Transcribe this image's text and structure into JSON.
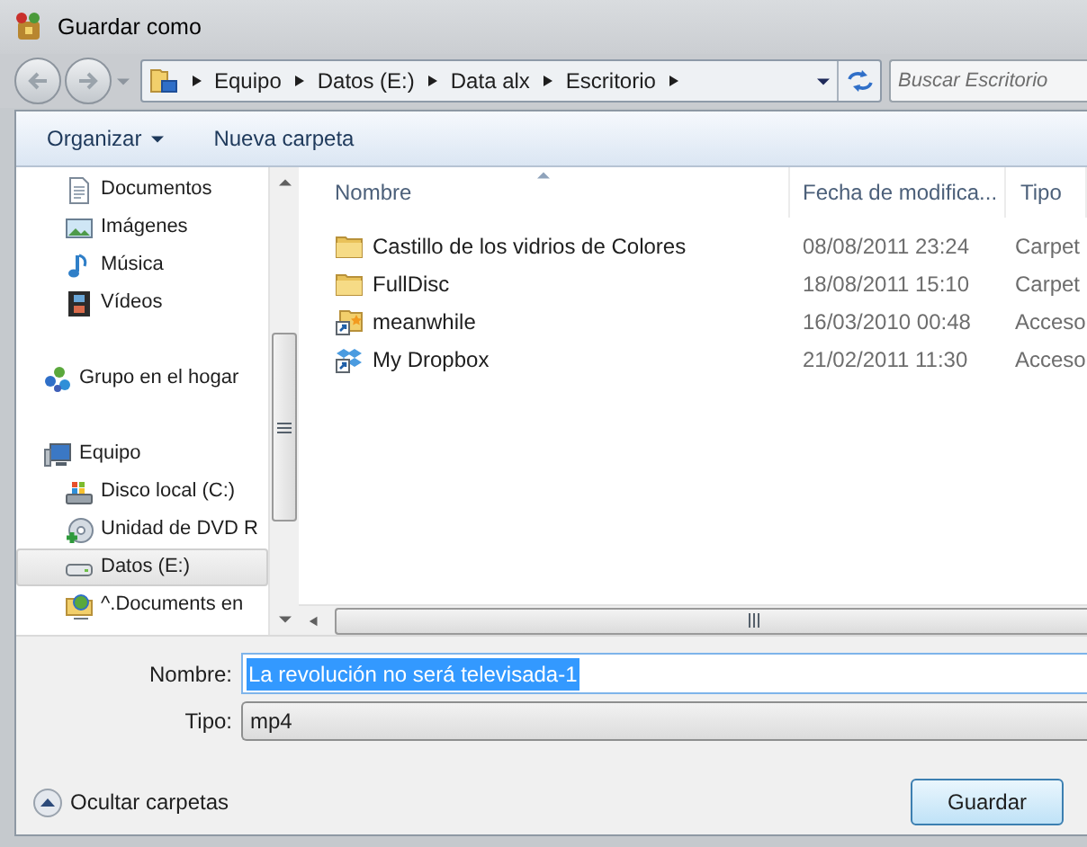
{
  "window": {
    "title": "Guardar como"
  },
  "address_bar": {
    "path": [
      "Equipo",
      "Datos (E:)",
      "Data alx",
      "Escritorio"
    ]
  },
  "search": {
    "placeholder": "Buscar Escritorio"
  },
  "toolbar": {
    "buttons": [
      {
        "label": "Organizar",
        "kind": "menu"
      },
      {
        "label": "Nueva carpeta",
        "kind": "plain"
      }
    ]
  },
  "sidebar": {
    "items": [
      {
        "children": [
          {
            "label": "Documentos",
            "selected": false
          },
          {
            "label": "Imágenes",
            "selected": false
          },
          {
            "label": "Música",
            "selected": false
          },
          {
            "label": "Vídeos",
            "selected": false
          }
        ]
      },
      {
        "label": "Grupo en el hogar",
        "selected": false
      },
      {
        "label": "Equipo",
        "selected": false,
        "children": [
          {
            "label": "Disco local (C:)",
            "selected": false
          },
          {
            "label": "Unidad de DVD R",
            "selected": false
          },
          {
            "label": "Datos (E:)",
            "selected": true
          },
          {
            "label": "^.Documents en",
            "selected": false
          }
        ]
      }
    ]
  },
  "file_list": {
    "columns": [
      {
        "label": "Nombre",
        "sorted": true
      },
      {
        "label": "Fecha de modifica...",
        "sorted": false
      },
      {
        "label": "Tipo",
        "sorted": false
      }
    ],
    "rows": [
      {
        "kind": "folder",
        "name": "Castillo de los vidrios de Colores",
        "date": "08/08/2011 23:24",
        "type": "Carpet"
      },
      {
        "kind": "folder",
        "name": "FullDisc",
        "date": "18/08/2011 15:10",
        "type": "Carpet"
      },
      {
        "kind": "shortcut",
        "name": "meanwhile",
        "date": "16/03/2010 00:48",
        "type": "Acceso"
      },
      {
        "kind": "shortcut",
        "name": "My Dropbox",
        "date": "21/02/2011 11:30",
        "type": "Acceso"
      }
    ]
  },
  "form": {
    "name_label": "Nombre:",
    "name_value": "La revolución no será televisada-1",
    "name_value_selected": true,
    "type_label": "Tipo:",
    "type_value": "mp4"
  },
  "footer": {
    "toggle_label": "Ocultar carpetas",
    "save_button": "Guardar"
  }
}
